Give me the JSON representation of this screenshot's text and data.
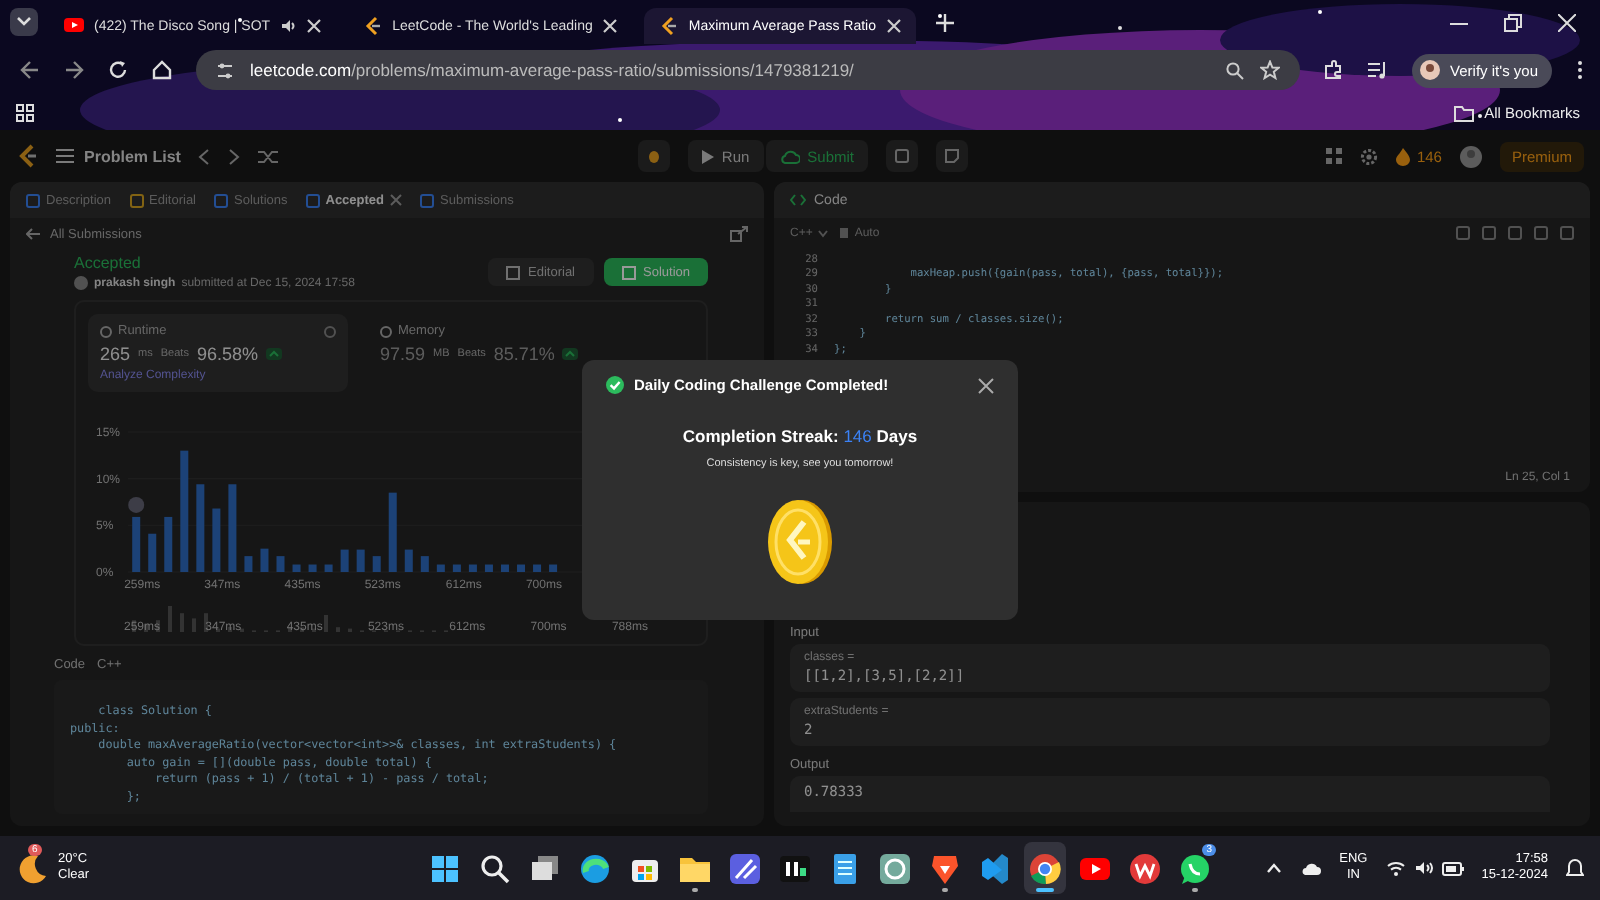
{
  "browser": {
    "tabs": [
      {
        "title": "(422) The Disco Song | SOT",
        "audio": true,
        "selected": false
      },
      {
        "title": "LeetCode - The World's Leading",
        "audio": false,
        "selected": false
      },
      {
        "title": "Maximum Average Pass Ratio",
        "audio": false,
        "selected": true
      }
    ],
    "url_host": "leetcode.com",
    "url_path": "/problems/maximum-average-pass-ratio/submissions/1479381219/",
    "profile_button": "Verify it's you",
    "bookmarks": "All Bookmarks"
  },
  "toolbar": {
    "problem_list": "Problem List",
    "run": "Run",
    "submit": "Submit",
    "streak": "146",
    "premium": "Premium"
  },
  "left_panel": {
    "tabs": [
      {
        "label": "Description",
        "selected": false,
        "closable": false
      },
      {
        "label": "Editorial",
        "selected": false,
        "closable": false
      },
      {
        "label": "Solutions",
        "selected": false,
        "closable": false
      },
      {
        "label": "Accepted",
        "selected": true,
        "closable": true
      },
      {
        "label": "Submissions",
        "selected": false,
        "closable": false
      }
    ],
    "back_link": "All Submissions",
    "status": "Accepted",
    "user": "prakash singh",
    "submitted": "submitted at Dec 15, 2024 17:58",
    "buttons": [
      {
        "label": "Editorial",
        "kind": "secondary"
      },
      {
        "label": "Solution",
        "kind": "primary"
      }
    ],
    "stats": [
      {
        "title": "Runtime",
        "value": "265",
        "unit": "ms",
        "beats_label": "Beats",
        "beats": "96.58%",
        "selected": true
      },
      {
        "title": "Memory",
        "value": "97.59",
        "unit": "MB",
        "beats_label": "Beats",
        "beats": "85.71%",
        "selected": false
      }
    ],
    "analyze": "Analyze Complexity",
    "chart_data": {
      "type": "bar",
      "x": [
        259,
        276.6,
        294.2,
        311.8,
        329.4,
        347,
        364.6,
        382.2,
        399.8,
        417.4,
        435,
        452.6,
        470.2,
        487.8,
        505.4,
        523,
        540.6,
        558.2,
        575.8,
        593.4,
        611,
        628.6,
        646.2,
        663.8,
        681.4,
        699,
        716.6
      ],
      "values": [
        5.9,
        4.1,
        5.9,
        13,
        9.4,
        6.8,
        9.4,
        1.7,
        2.5,
        1.7,
        0.8,
        0.8,
        0.8,
        2.4,
        2.4,
        1.7,
        8.5,
        2.4,
        1.7,
        0.8,
        0.8,
        0.8,
        0.8,
        0.8,
        0.8,
        0.8,
        0.8
      ],
      "xticks": [
        {
          "value": 259,
          "label": "259ms"
        },
        {
          "value": 347,
          "label": "347ms"
        },
        {
          "value": 435,
          "label": "435ms"
        },
        {
          "value": 523,
          "label": "523ms"
        },
        {
          "value": 612,
          "label": "612ms"
        },
        {
          "value": 700,
          "label": "700ms"
        }
      ],
      "xlim": [
        250,
        722
      ],
      "yticks": [
        {
          "value": 0,
          "label": "0%"
        },
        {
          "value": 5,
          "label": "5%"
        },
        {
          "value": 10,
          "label": "10%"
        },
        {
          "value": 15,
          "label": "15%"
        }
      ],
      "ylim": [
        0,
        15
      ]
    },
    "range_labels": [
      "259ms",
      "347ms",
      "435ms",
      "523ms",
      "612ms",
      "700ms",
      "788ms"
    ],
    "code_title": "Code",
    "code_language": "C++",
    "code_lines": [
      "    class Solution {",
      "public:",
      "    double maxAverageRatio(vector<vector<int>>& classes, int extraStudents) {",
      "        auto gain = [](double pass, double total) {",
      "            return (pass + 1) / (total + 1) - pass / total;",
      "        };"
    ]
  },
  "code_panel": {
    "title": "Code",
    "language": "C++",
    "mode": "Auto",
    "lines": [
      {
        "number": "28"
      },
      {
        "number": "29",
        "text": "            maxHeap.push({gain(pass, total), {pass, total}});"
      },
      {
        "number": "30",
        "text": "        }"
      },
      {
        "number": "31"
      },
      {
        "number": "32",
        "text": "        return sum / classes.size();"
      },
      {
        "number": "33",
        "text": "    }"
      },
      {
        "number": "34",
        "text": "};"
      }
    ],
    "cursor": "Ln 25, Col 1"
  },
  "testcase": {
    "input_label": "Input",
    "inputs": [
      {
        "name": "classes =",
        "value": "[[1,2],[3,5],[2,2]]"
      },
      {
        "name": "extraStudents =",
        "value": "2"
      }
    ],
    "output_label": "Output",
    "output": "0.78333"
  },
  "modal": {
    "title": "Daily Coding Challenge Completed!",
    "streak_label": "Completion Streak:",
    "streak": "146",
    "streak_unit": "Days",
    "message": "Consistency is key, see you tomorrow!"
  },
  "taskbar": {
    "weather": {
      "temp": "20°C",
      "condition": "Clear",
      "badge": "6"
    },
    "apps": [
      {
        "kind": "start",
        "running": false,
        "selected": false
      },
      {
        "kind": "search",
        "running": false,
        "selected": false
      },
      {
        "kind": "taskview",
        "running": false,
        "selected": false
      },
      {
        "kind": "edge",
        "running": false,
        "selected": false
      },
      {
        "kind": "store",
        "running": false,
        "selected": false
      },
      {
        "kind": "folder",
        "running": true,
        "selected": false
      },
      {
        "kind": "mapp",
        "running": false,
        "selected": false
      },
      {
        "kind": "hn",
        "running": false,
        "selected": false
      },
      {
        "kind": "notepad",
        "running": false,
        "selected": false
      },
      {
        "kind": "chatgpt",
        "running": false,
        "selected": false
      },
      {
        "kind": "brave",
        "running": true,
        "selected": false
      },
      {
        "kind": "vscode",
        "running": false,
        "selected": false
      },
      {
        "kind": "chrome",
        "running": true,
        "selected": true
      },
      {
        "kind": "youtube",
        "running": false,
        "selected": false
      },
      {
        "kind": "wps",
        "running": false,
        "selected": false
      },
      {
        "kind": "whatsapp",
        "running": true,
        "selected": false,
        "badge": "3"
      }
    ],
    "lang": "ENG",
    "region": "IN",
    "time": "17:58",
    "date": "15-12-2024"
  }
}
